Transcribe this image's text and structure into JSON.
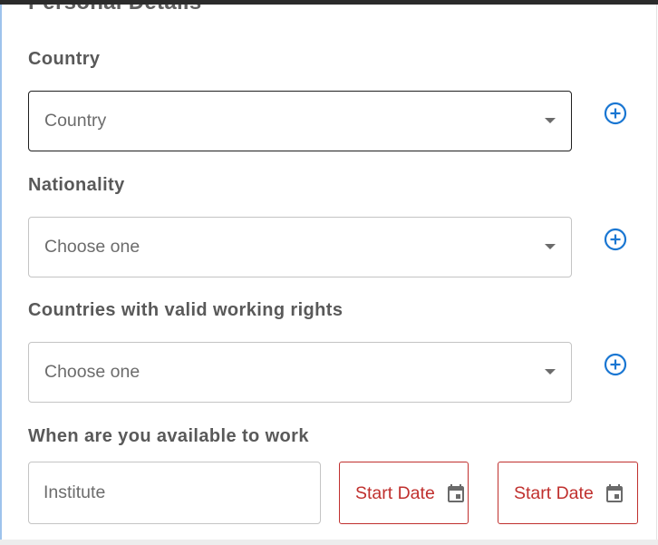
{
  "section": {
    "title": "Personal Details"
  },
  "fields": {
    "country": {
      "label": "Country",
      "value": "Country"
    },
    "nationality": {
      "label": "Nationality",
      "placeholder": "Choose one"
    },
    "working_rights": {
      "label": "Countries with valid working rights",
      "placeholder": "Choose one"
    },
    "availability": {
      "label": "When are you available to work",
      "institute_placeholder": "Institute",
      "start_date_1": "Start Date",
      "start_date_2": "Start Date"
    }
  },
  "icons": {
    "add": "plus-circle-icon",
    "dropdown": "chevron-down-icon",
    "calendar": "calendar-icon"
  },
  "colors": {
    "accent_blue": "#1976d2",
    "error_red": "#c0302e",
    "label_gray": "#595959"
  }
}
